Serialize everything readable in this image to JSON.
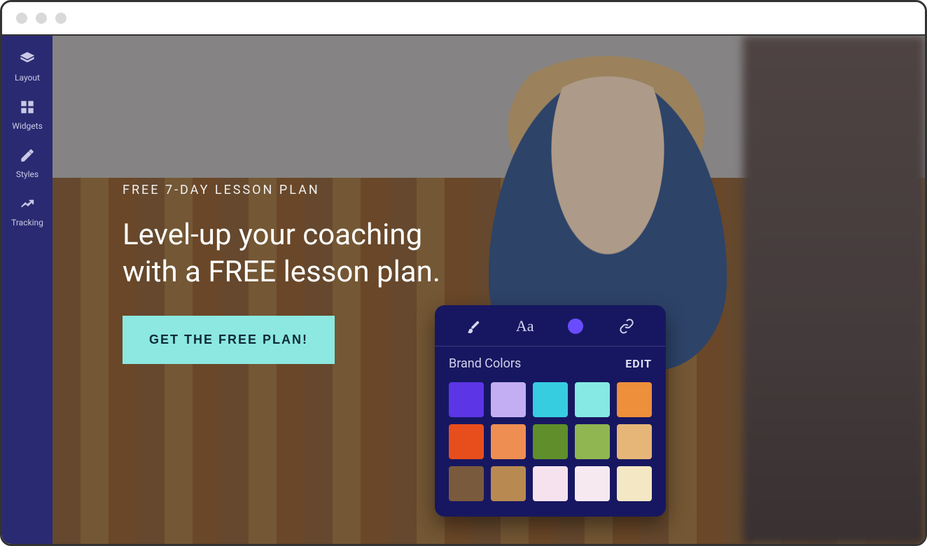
{
  "sidebar": {
    "items": [
      {
        "label": "Layout",
        "icon": "layers-icon"
      },
      {
        "label": "Widgets",
        "icon": "widgets-icon"
      },
      {
        "label": "Styles",
        "icon": "pencil-icon"
      },
      {
        "label": "Tracking",
        "icon": "tracking-icon"
      }
    ]
  },
  "hero": {
    "eyebrow": "FREE 7-DAY LESSON PLAN",
    "headline": "Level-up your coaching with a FREE lesson plan.",
    "cta_label": "GET THE FREE PLAN!"
  },
  "popover": {
    "title": "Brand Colors",
    "edit_label": "EDIT",
    "swatches": [
      "#5b35e6",
      "#c3aef3",
      "#37cde0",
      "#86e9e3",
      "#ed8f3b",
      "#e84e1c",
      "#ee8e53",
      "#5f8e2b",
      "#8fb651",
      "#e6b678",
      "#7a5a3c",
      "#b88a52",
      "#f6e1ee",
      "#f6e9f0",
      "#f3e7c4"
    ]
  }
}
